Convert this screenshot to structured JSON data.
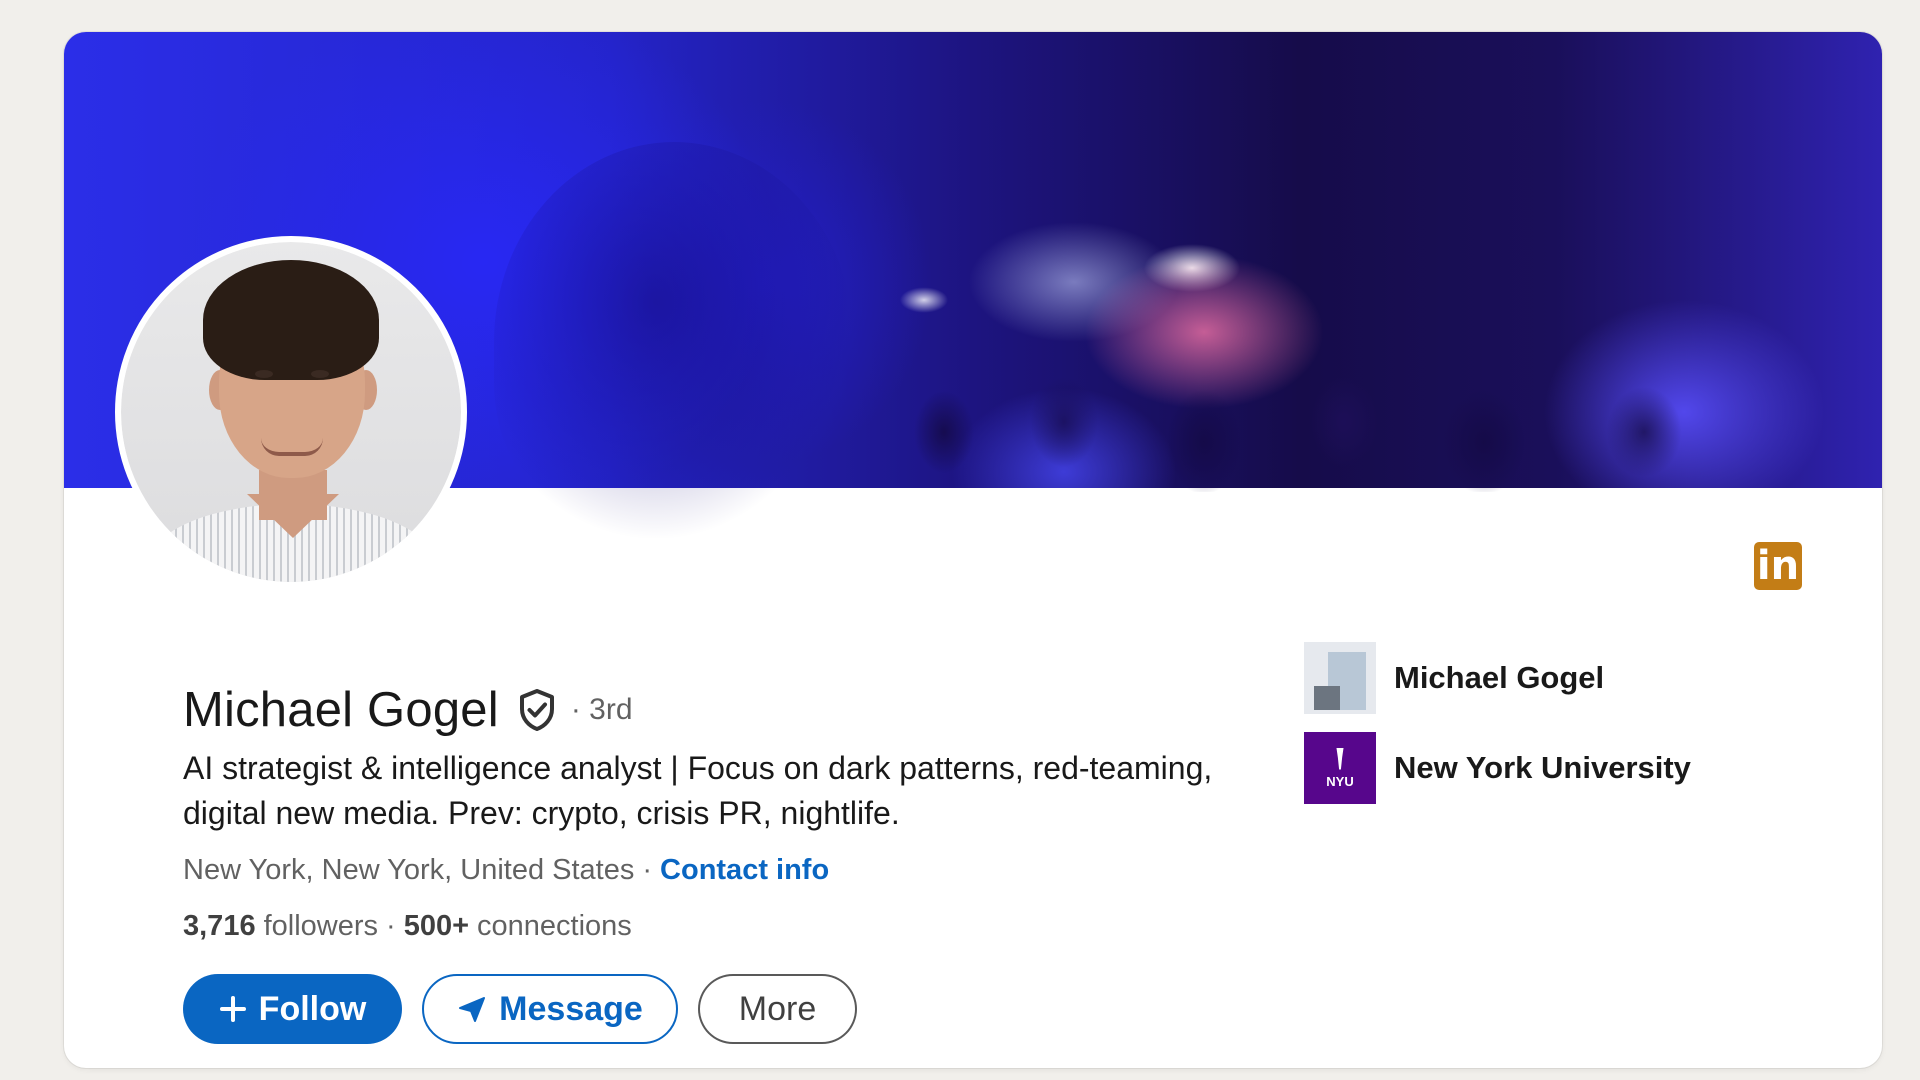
{
  "profile": {
    "name": "Michael Gogel",
    "degree": "· 3rd",
    "headline": "AI strategist & intelligence analyst | Focus on dark patterns, red-teaming, digital new media. Prev: crypto, crisis PR, nightlife.",
    "location": "New York, New York, United States",
    "contact_label": "Contact info",
    "followers_count": "3,716",
    "followers_label": "followers",
    "connections_count": "500+",
    "connections_label": "connections"
  },
  "actions": {
    "follow_label": "Follow",
    "message_label": "Message",
    "more_label": "More"
  },
  "orgs": [
    {
      "label": "Michael Gogel",
      "icon": "company-logo"
    },
    {
      "label": "New York University",
      "icon": "nyu-logo",
      "logo_text": "NYU"
    }
  ],
  "brand": {
    "linkedin_text": "in",
    "primary": "#0a66c2",
    "linkedin_badge": "#c37d16",
    "nyu_purple": "#57068c"
  },
  "icons": {
    "verified": "shield-check-icon",
    "follow": "plus-icon",
    "message": "paper-plane-icon"
  }
}
